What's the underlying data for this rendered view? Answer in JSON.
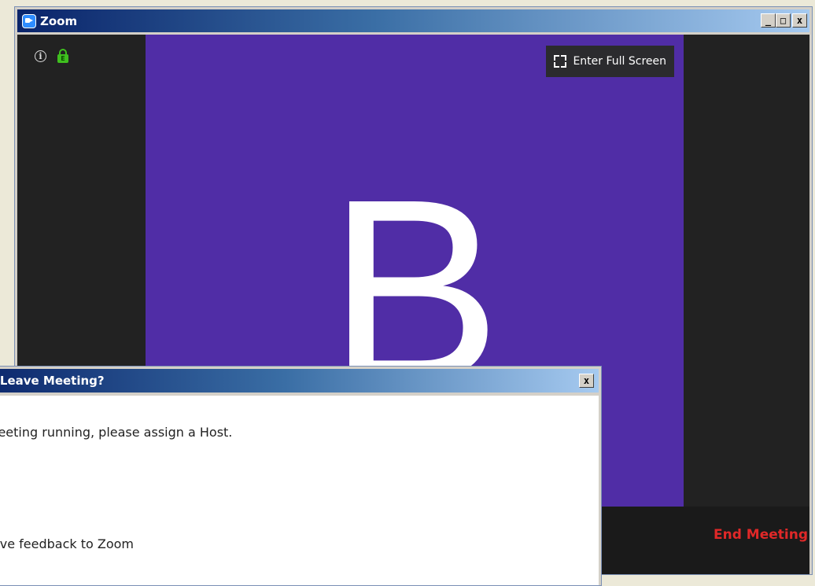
{
  "window": {
    "title": "Zoom",
    "controls": {
      "minimize": "_",
      "maximize": "□",
      "close": "x"
    }
  },
  "meeting": {
    "info_icon": "info-icon",
    "lock_icon": "lock-icon",
    "lock_badge": "E",
    "fullscreen_label": "Enter Full Screen",
    "avatar_letter": "B",
    "video_bg": "#502da6",
    "end_meeting_label": "End Meeting",
    "end_meeting_color": "#e02828"
  },
  "dialog": {
    "title": "g or Leave Meeting?",
    "close": "x",
    "message": "is meeting running, please assign a Host.",
    "feedback": " to give feedback to Zoom"
  }
}
